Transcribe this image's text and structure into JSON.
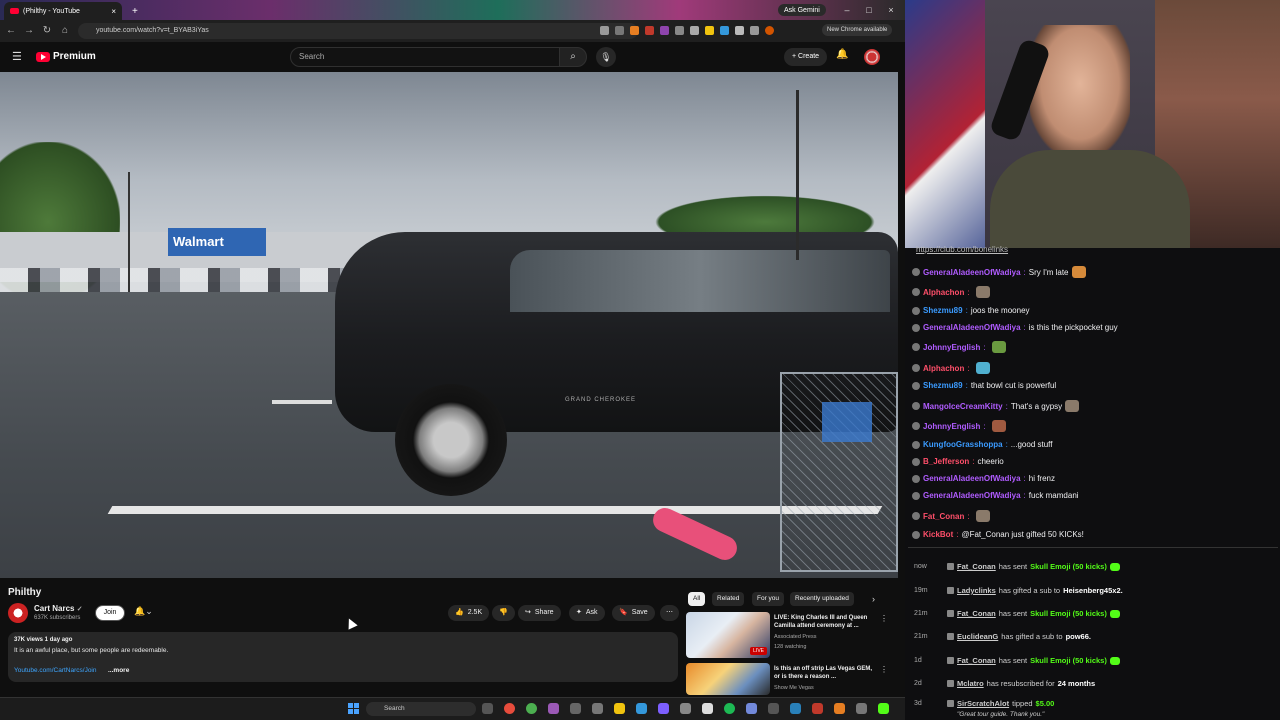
{
  "browser": {
    "tab_title": "(Philthy - YouTube",
    "url": "youtube.com/watch?v=t_BYAB3iYas",
    "gemini_label": "Ask Gemini",
    "update_badge": "New Chrome available"
  },
  "youtube": {
    "logo_text": "Premium",
    "search_placeholder": "Search",
    "create_label": "Create",
    "video": {
      "title": "Philthy",
      "channel": "Cart Narcs",
      "subscribers": "637K subscribers",
      "join_label": "Join",
      "likes": "2.5K",
      "share_label": "Share",
      "ask_label": "Ask",
      "save_label": "Save",
      "meta": "37K views  1 day ago",
      "description": "It is an awful place, but some people are redeemable.",
      "link": "Youtube.com/CartNarcs/Join",
      "more": "...more",
      "store_sign": "Walmart",
      "cart_text": "GRAND CHEROKEE"
    },
    "chips": [
      "All",
      "Related",
      "For you",
      "Recently uploaded"
    ],
    "recommendations": [
      {
        "title": "LIVE: King Charles III and Queen Camilla attend ceremony at ...",
        "channel": "Associated Press",
        "extra": "128 watching",
        "badge": "LIVE"
      },
      {
        "title": "Is this an off strip Las Vegas GEM, or is there a reason ...",
        "channel": "Show Me Vegas",
        "extra": "",
        "badge": ""
      }
    ]
  },
  "taskbar": {
    "search_label": "Search"
  },
  "chat": {
    "header_link": "https://club.com/bonelinks",
    "messages": [
      {
        "user": "GeneralAladeenOfWadiya",
        "color": "#b05cff",
        "text": "Sry I'm late",
        "emote": true
      },
      {
        "user": "Alphachon",
        "color": "#ff4f6a",
        "text": "",
        "emote": true
      },
      {
        "user": "Shezmu89",
        "color": "#3b9bff",
        "text": "joos the mooney",
        "emote": false
      },
      {
        "user": "GeneralAladeenOfWadiya",
        "color": "#b05cff",
        "text": "is this the pickpocket guy",
        "emote": false
      },
      {
        "user": "JohnnyEnglish",
        "color": "#b05cff",
        "text": "",
        "emote": true
      },
      {
        "user": "Alphachon",
        "color": "#ff4f6a",
        "text": "",
        "emote": true
      },
      {
        "user": "Shezmu89",
        "color": "#3b9bff",
        "text": "that bowl cut is powerful",
        "emote": false
      },
      {
        "user": "MangoIceCreamKitty",
        "color": "#b05cff",
        "text": "That's a gypsy",
        "emote": true
      },
      {
        "user": "JohnnyEnglish",
        "color": "#b05cff",
        "text": "",
        "emote": true
      },
      {
        "user": "KungfooGrasshoppa",
        "color": "#3b9bff",
        "text": "...good stuff",
        "emote": false
      },
      {
        "user": "B_Jefferson",
        "color": "#ff4f6a",
        "text": "cheerio",
        "emote": false
      },
      {
        "user": "GeneralAladeenOfWadiya",
        "color": "#b05cff",
        "text": "hi frenz",
        "emote": false
      },
      {
        "user": "GeneralAladeenOfWadiya",
        "color": "#b05cff",
        "text": "fuck mamdani",
        "emote": false
      },
      {
        "user": "Fat_Conan",
        "color": "#ff4f6a",
        "text": "",
        "emote": true
      },
      {
        "user": "KickBot",
        "color": "#ff4f6a",
        "text": "@Fat_Conan just gifted 50 KICKs!",
        "emote": false
      }
    ],
    "events": [
      {
        "time": "now",
        "user": "Fat_Conan",
        "pre": "has sent",
        "highlight": "Skull Emoji (50 kicks)",
        "post": ""
      },
      {
        "time": "19m",
        "user": "Ladyclinks",
        "pre": "has gifted a sub to",
        "highlight": "",
        "post": "Heisenberg45x2."
      },
      {
        "time": "21m",
        "user": "Fat_Conan",
        "pre": "has sent",
        "highlight": "Skull Emoji (50 kicks)",
        "post": ""
      },
      {
        "time": "21m",
        "user": "EuclideanG",
        "pre": "has gifted a sub to",
        "highlight": "",
        "post": "pow66."
      },
      {
        "time": "1d",
        "user": "Fat_Conan",
        "pre": "has sent",
        "highlight": "Skull Emoji (50 kicks)",
        "post": ""
      },
      {
        "time": "2d",
        "user": "Mclatro",
        "pre": "has resubscribed for",
        "highlight": "",
        "post": "24 months"
      },
      {
        "time": "3d",
        "user": "SirScratchAlot",
        "pre": "tipped",
        "highlight": "$5.00",
        "post": ""
      }
    ],
    "tip_message": "\"Great tour guide. Thank you.\""
  },
  "colors": {
    "accent": "#ff0033",
    "kick_green": "#53fc18",
    "link_blue": "#3ea6ff"
  }
}
